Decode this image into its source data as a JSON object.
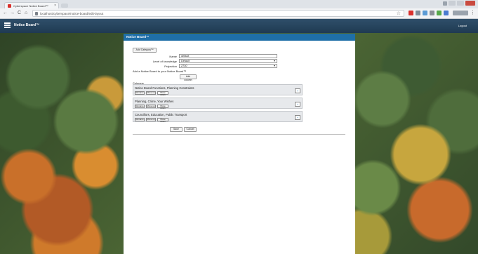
{
  "browser": {
    "tab_title": "Cyberspace Notice Board™",
    "tab_close": "×",
    "url": "localhost/cyberspace/notice-board/edit-layout",
    "star": "☆",
    "back": "←",
    "forward": "→",
    "reload": "C",
    "home": "⌂"
  },
  "app": {
    "name": "Notice Board™",
    "logout": "Logout"
  },
  "modal": {
    "title": "Notice Board™",
    "top_button": "Add Category™",
    "fields": [
      {
        "label": "Name",
        "value": "default"
      },
      {
        "label": "Level of knowledge",
        "value": "Default"
      },
      {
        "label": "Projection",
        "value": "2730"
      }
    ],
    "note": "Add a Notice Board to your Notice Board™",
    "add_column_button": "Add column",
    "columns_label": "Columns",
    "panels": [
      {
        "title": "Notice Board Functions, Planning Constraints",
        "buttons": [
          "Rename",
          "Move up",
          "Move down"
        ]
      },
      {
        "title": "Planning, Crime, Your Wishes",
        "buttons": [
          "Rename",
          "Move up",
          "Move down"
        ]
      },
      {
        "title": "Councillors, Education, Public Transport",
        "buttons": [
          "Rename",
          "Move up",
          "Move down"
        ]
      }
    ],
    "plus_symbol": "+",
    "save_button": "Save",
    "cancel_button": "Cancel"
  },
  "colors": {
    "header": "#1f3a52",
    "modal_title": "#1f6fa8"
  }
}
